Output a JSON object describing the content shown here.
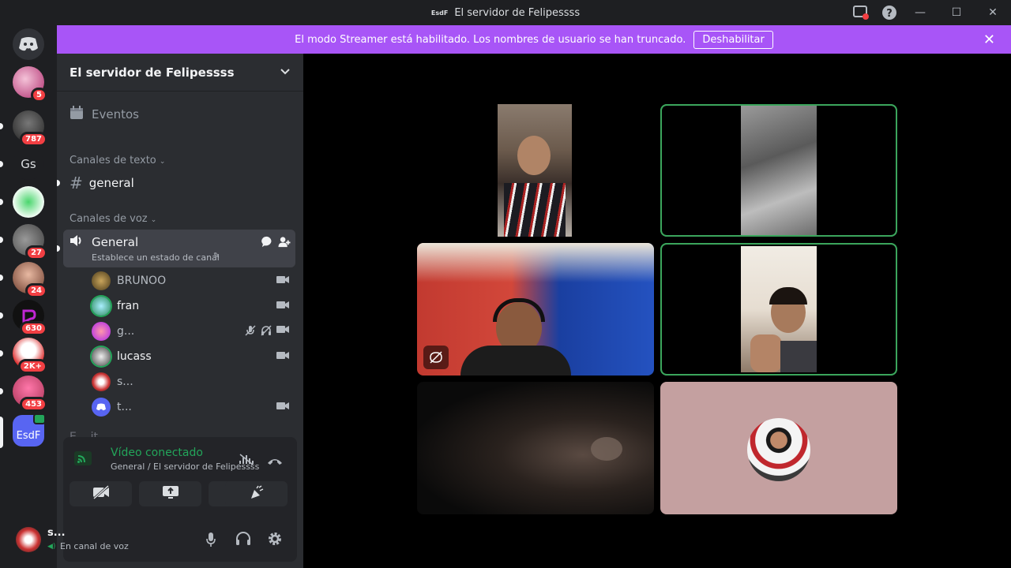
{
  "window": {
    "title": "El servidor de Felipessss",
    "icon_text": "EsdF"
  },
  "banner": {
    "text": "El modo Streamer está habilitado. Los nombres de usuario se han truncado.",
    "button": "Deshabilitar"
  },
  "guilds": [
    {
      "badge": "5"
    },
    {
      "badge": "787"
    },
    {
      "label": "Gs",
      "badge": ""
    },
    {
      "badge": ""
    },
    {
      "badge": "27"
    },
    {
      "badge": "24"
    },
    {
      "badge": "630"
    },
    {
      "badge": "2K+"
    },
    {
      "badge": "453"
    },
    {
      "label": "EsdF",
      "badge": ""
    }
  ],
  "server": {
    "name": "El servidor de Felipessss",
    "events": "Eventos"
  },
  "categories": {
    "text": "Canales de texto",
    "voice": "Canales de voz"
  },
  "text_channels": [
    {
      "name": "general"
    }
  ],
  "voice_channel": {
    "name": "General",
    "status": "Establece un estado de canal"
  },
  "members": [
    {
      "name": "BRUNOO",
      "icons": [
        "video"
      ]
    },
    {
      "name": "fran",
      "icons": [
        "video"
      ]
    },
    {
      "name": "g...",
      "icons": [
        "mic-muted",
        "deafened",
        "video"
      ]
    },
    {
      "name": "lucass",
      "icons": [
        "video"
      ]
    },
    {
      "name": "s...",
      "icons": []
    },
    {
      "name": "t...",
      "icons": [
        "video"
      ]
    }
  ],
  "next_channel_partial": "E... it...",
  "voice_status": {
    "title": "Vídeo conectado",
    "subtitle": "General / El servidor de Felipessss"
  },
  "user": {
    "name": "s...",
    "status": "En canal de voz"
  },
  "colors": {
    "accent": "#a855f7",
    "connected": "#23a55a",
    "badge": "#f23f43",
    "speaking": "#3ba55c"
  }
}
